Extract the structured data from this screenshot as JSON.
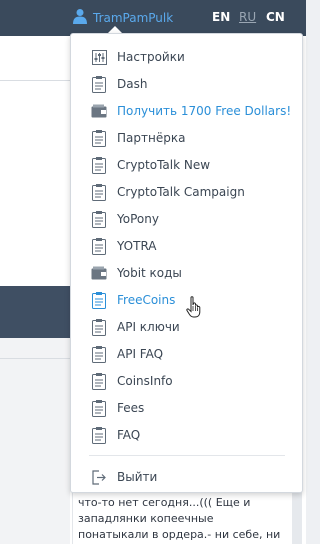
{
  "header": {
    "user_name": "TramPamPulk",
    "languages": [
      {
        "code": "EN",
        "active": false
      },
      {
        "code": "RU",
        "active": true
      },
      {
        "code": "CN",
        "active": false
      }
    ]
  },
  "menu": {
    "items": [
      {
        "label": "Настройки",
        "icon": "settings-sliders-icon"
      },
      {
        "label": "Dash",
        "icon": "clipboard-icon"
      },
      {
        "label": "Получить 1700 Free Dollars!",
        "icon": "wallet-icon",
        "highlight": true
      },
      {
        "label": "Партнёрка",
        "icon": "clipboard-icon"
      },
      {
        "label": "CryptoTalk New",
        "icon": "clipboard-icon"
      },
      {
        "label": "CryptoTalk Campaign",
        "icon": "clipboard-icon"
      },
      {
        "label": "YoPony",
        "icon": "clipboard-icon"
      },
      {
        "label": "YOTRA",
        "icon": "clipboard-icon"
      },
      {
        "label": "Yobit коды",
        "icon": "wallet-icon"
      },
      {
        "label": "FreeCoins",
        "icon": "clipboard-icon",
        "highlight": true
      },
      {
        "label": "API ключи",
        "icon": "clipboard-icon"
      },
      {
        "label": "API FAQ",
        "icon": "clipboard-icon"
      },
      {
        "label": "CoinsInfo",
        "icon": "clipboard-icon"
      },
      {
        "label": "Fees",
        "icon": "clipboard-icon"
      },
      {
        "label": "FAQ",
        "icon": "clipboard-icon"
      }
    ],
    "logout_label": "Выйти"
  },
  "comment": {
    "line1": "что-то нет сегодня...((( Еще и",
    "line2": "западлянки копеечные",
    "line3": "понатыкали в ордера.- ни себе, ни"
  },
  "colors": {
    "header_bg": "#3a4a5c",
    "link_blue": "#2b8fd8",
    "text": "#3b4653"
  }
}
